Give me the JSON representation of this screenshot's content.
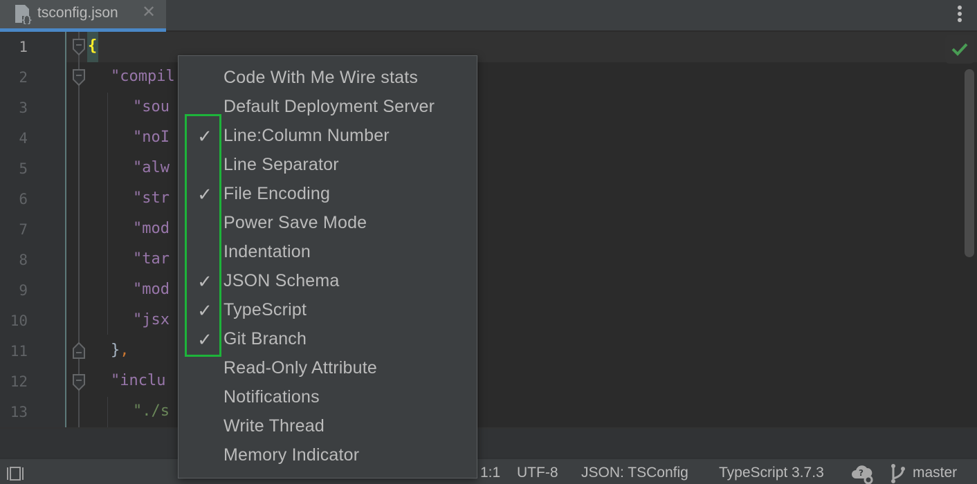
{
  "tab": {
    "filename": "tsconfig.json",
    "icon": "json-file-icon",
    "close_glyph": "✕"
  },
  "editor": {
    "current_line": 1,
    "lines": [
      {
        "num": "1",
        "text": "{"
      },
      {
        "num": "2",
        "text": "\"compil"
      },
      {
        "num": "3",
        "text": "\"sou"
      },
      {
        "num": "4",
        "text": "\"noI"
      },
      {
        "num": "5",
        "text": "\"alw"
      },
      {
        "num": "6",
        "text": "\"str"
      },
      {
        "num": "7",
        "text": "\"mod"
      },
      {
        "num": "8",
        "text": "\"tar"
      },
      {
        "num": "9",
        "text": "\"mod"
      },
      {
        "num": "10",
        "text": "\"jsx"
      },
      {
        "num": "11",
        "text": "},"
      },
      {
        "num": "12",
        "text": "\"inclu"
      },
      {
        "num": "13",
        "text": "\"./s"
      }
    ],
    "inspection_status": "ok-check-icon"
  },
  "popup_menu": {
    "items": [
      {
        "label": "Code With Me Wire stats",
        "checked": false
      },
      {
        "label": "Default Deployment Server",
        "checked": false
      },
      {
        "label": "Line:Column Number",
        "checked": true
      },
      {
        "label": "Line Separator",
        "checked": false
      },
      {
        "label": "File Encoding",
        "checked": true
      },
      {
        "label": "Power Save Mode",
        "checked": false
      },
      {
        "label": "Indentation",
        "checked": false
      },
      {
        "label": "JSON Schema",
        "checked": true
      },
      {
        "label": "TypeScript",
        "checked": true
      },
      {
        "label": "Git Branch",
        "checked": true
      },
      {
        "label": "Read-Only Attribute",
        "checked": false
      },
      {
        "label": "Notifications",
        "checked": false
      },
      {
        "label": "Write Thread",
        "checked": false
      },
      {
        "label": "Memory Indicator",
        "checked": false
      }
    ],
    "check_glyph": "✓",
    "highlight_color": "#1db33a"
  },
  "statusbar": {
    "position": "1:1",
    "encoding": "UTF-8",
    "json_schema": "JSON: TSConfig",
    "typescript": "TypeScript 3.7.3",
    "branch": "master"
  },
  "colors": {
    "accent": "#4a88c7",
    "key": "#9876aa",
    "string": "#6a8759",
    "brace_match": "#ffef28",
    "ok_green": "#499c54"
  }
}
